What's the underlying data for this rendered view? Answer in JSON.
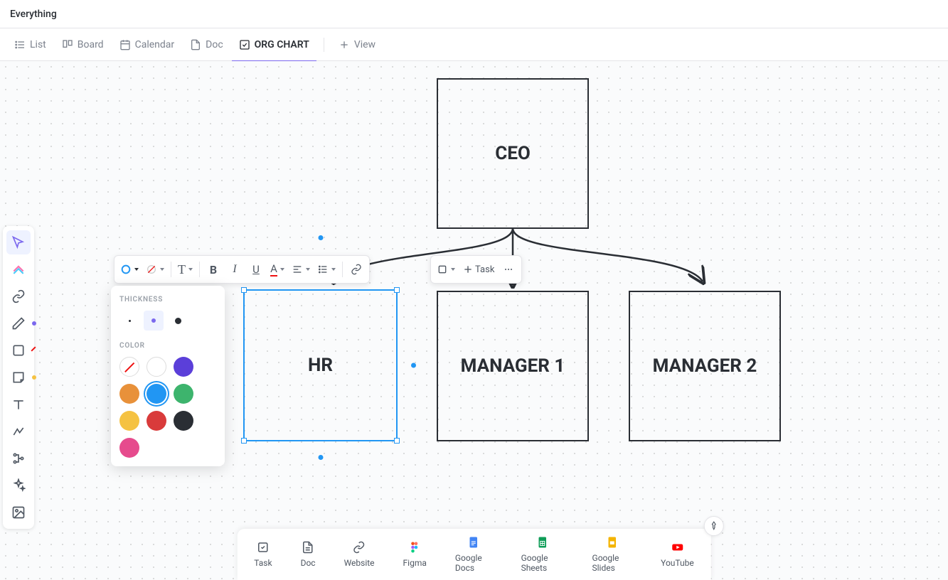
{
  "header": {
    "breadcrumb": "Everything"
  },
  "views": {
    "list": "List",
    "board": "Board",
    "calendar": "Calendar",
    "doc": "Doc",
    "orgchart": "ORG CHART",
    "addview": "View"
  },
  "nodes": {
    "ceo": "CEO",
    "hr": "HR",
    "mgr1": "MANAGER 1",
    "mgr2": "MANAGER 2"
  },
  "toolbar": {
    "task": "Task"
  },
  "panel": {
    "thickness_label": "THICKNESS",
    "color_label": "COLOR",
    "thickness_options": [
      "2",
      "4",
      "7"
    ],
    "thickness_selected": 1,
    "colors": [
      {
        "name": "none",
        "value": "none"
      },
      {
        "name": "white",
        "value": "#ffffff"
      },
      {
        "name": "purple",
        "value": "#5b3fd9"
      },
      {
        "name": "orange",
        "value": "#e8913a"
      },
      {
        "name": "blue",
        "value": "#2196f3",
        "selected": true
      },
      {
        "name": "green",
        "value": "#3db46d"
      },
      {
        "name": "yellow",
        "value": "#f5c242"
      },
      {
        "name": "red",
        "value": "#d93b3b"
      },
      {
        "name": "black",
        "value": "#2a2e34"
      },
      {
        "name": "pink",
        "value": "#e64b8d"
      }
    ]
  },
  "bottom": {
    "task": "Task",
    "doc": "Doc",
    "website": "Website",
    "figma": "Figma",
    "gdocs": "Google Docs",
    "gsheets": "Google Sheets",
    "gslides": "Google Slides",
    "youtube": "YouTube"
  }
}
